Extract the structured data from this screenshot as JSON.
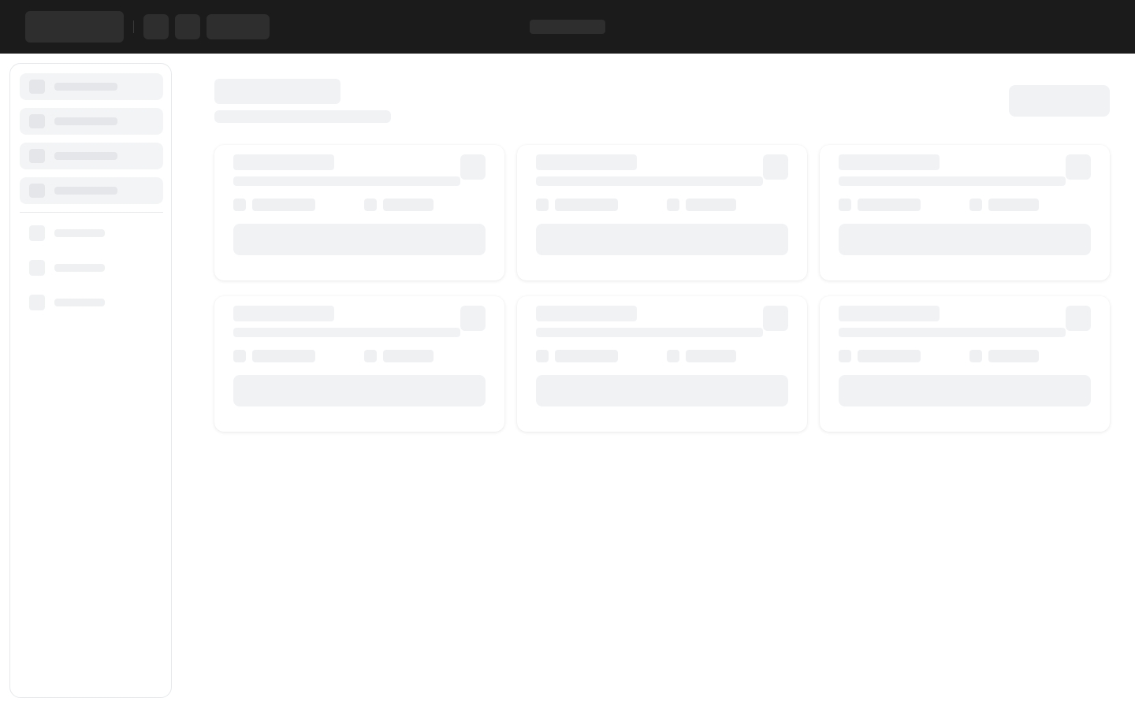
{
  "app": {
    "state": "loading"
  },
  "colors": {
    "topbar": "#1b1b1b",
    "topbar_placeholder": "#2e2e2e",
    "placeholder": "#f1f2f4",
    "card_bg": "#ffffff",
    "border": "#e6e8eb"
  },
  "sidebar": {
    "primary_items": 4,
    "secondary_items": 3
  },
  "main": {
    "cards": 6
  }
}
